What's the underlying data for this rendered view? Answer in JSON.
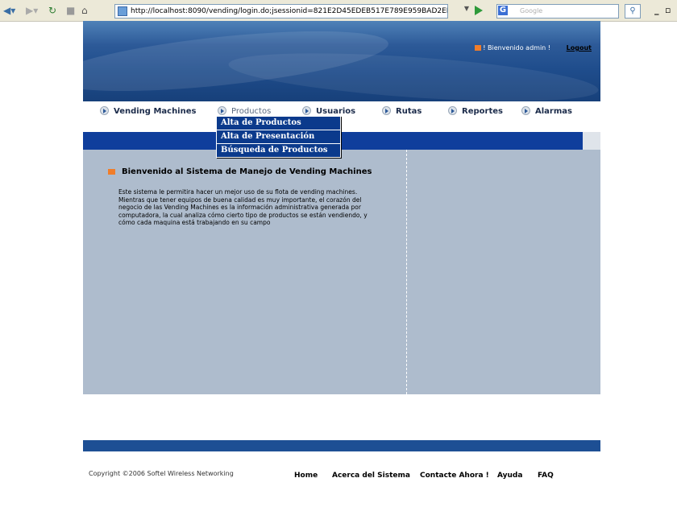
{
  "browser": {
    "url": "http://localhost:8090/vending/login.do;jsessionid=821E2D45EDEB517E789E959BAD2EB424",
    "search_placeholder": "Google",
    "search_logo": "G"
  },
  "header": {
    "welcome": "! Bienvenido admin !",
    "logout": "Logout"
  },
  "nav": {
    "items": [
      {
        "label": "Vending Machines"
      },
      {
        "label": "Productos"
      },
      {
        "label": "Usuarios"
      },
      {
        "label": "Rutas"
      },
      {
        "label": "Reportes"
      },
      {
        "label": "Alarmas"
      }
    ],
    "dropdown": [
      {
        "label": "Alta de Productos"
      },
      {
        "label": "Alta de Presentación"
      },
      {
        "label": "Búsqueda de Productos"
      }
    ]
  },
  "main": {
    "title": "Bienvenido al Sistema de Manejo de Vending Machines",
    "body": "Este sistema le permitira hacer un mejor uso de su flota de vending machines. Mientras que tener equipos de buena calidad es muy importante, el corazón del negocio de las Vending Machines es la información administrativa generada por computadora, la cual analiza cómo cierto tipo de productos se están vendiendo, y cómo cada maquina está trabajando en su campo"
  },
  "footer": {
    "copyright": "Copyright ©2006 Softel Wireless Networking",
    "links": [
      {
        "label": "Home"
      },
      {
        "label": "Acerca del Sistema"
      },
      {
        "label": "Contacte Ahora !"
      },
      {
        "label": "Ayuda"
      },
      {
        "label": "FAQ"
      }
    ]
  },
  "colors": {
    "header_blue": "#1f4d8c",
    "menu_blue": "#0b3a8c",
    "content_bg": "#aebccd",
    "accent_orange": "#f07d2a"
  }
}
